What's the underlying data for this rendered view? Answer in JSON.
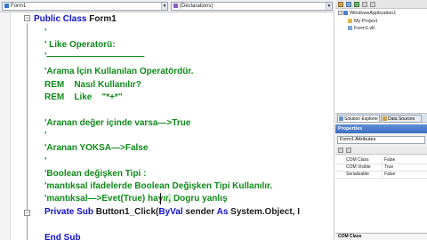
{
  "navbar": {
    "class_combo": "Form1",
    "method_combo": "(Declarations)"
  },
  "code": {
    "lines": [
      {
        "k": "Public Class",
        "t": " Form1"
      },
      {
        "c": "'"
      },
      {
        "c": "' Like Operatorü:"
      },
      {
        "c": "'———————————"
      },
      {
        "c": "'Arama İçin Kullanılan Operatördür."
      },
      {
        "c": "REM    Nasıl Kullanılır?"
      },
      {
        "c": "REM    Like    \"*+*\""
      },
      {
        "c": "'Aranan değer içinde varsa—>True"
      },
      {
        "c": "'"
      },
      {
        "c": "'Aranan YOKSA—>False"
      },
      {
        "c": "'"
      },
      {
        "c": "'Boolean değişken Tipi :"
      },
      {
        "c": "'mantıksal ifadelerde Boolean Değişken Tipi Kullanılır."
      },
      {
        "c1": "'mantıksal—>Evet(True) hayır",
        "hl": ",",
        "c2": " Dogru yanlış"
      },
      {
        "k1": "Private Sub",
        "t1": " Button1_Click(",
        "k2": "ByVal",
        "t2": " sender ",
        "k3": "As",
        "t3": " System.Object, I"
      },
      {
        "k": "End Sub",
        "t": ""
      }
    ]
  },
  "solution_explorer": {
    "solution_name": "WindowsApplication1",
    "items": [
      "My Project",
      "Form1.vb"
    ]
  },
  "tabs": {
    "solution": "Solution Explorer",
    "dataset": "Data Sources"
  },
  "properties": {
    "title": "Properties",
    "object": "Form1  Attributes",
    "rows": [
      {
        "name": "COM Class",
        "value": "False"
      },
      {
        "name": "COM Visible",
        "value": "True"
      },
      {
        "name": "Serializable",
        "value": "False"
      }
    ],
    "description": "COM Class"
  },
  "colors": {
    "keyword": "#1010cc",
    "comment": "#0f8a1a",
    "panel_title": "#3c6fc2"
  },
  "icons": [
    "chevron-down-icon",
    "class-icon",
    "method-icon",
    "collapse-icon",
    "solution-icon",
    "project-icon",
    "folder-icon",
    "form-icon"
  ]
}
